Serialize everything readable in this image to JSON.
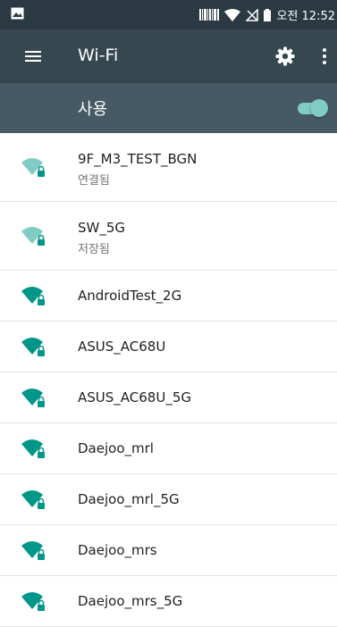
{
  "status_bar": {
    "time": "오전 12:52",
    "icons": [
      "image-icon",
      "barcode-icon",
      "wifi-icon",
      "no-sim-icon",
      "battery-icon"
    ]
  },
  "toolbar": {
    "title": "Wi-Fi",
    "icons": [
      "menu-icon",
      "gear-icon",
      "more-vert-icon"
    ]
  },
  "master_switch": {
    "label": "사용",
    "on": true
  },
  "networks": [
    {
      "ssid": "9F_M3_TEST_BGN",
      "summary": "연결됨",
      "signal": "faded"
    },
    {
      "ssid": "SW_5G",
      "summary": "저장됨",
      "signal": "faded"
    },
    {
      "ssid": "AndroidTest_2G",
      "signal": "full"
    },
    {
      "ssid": "ASUS_AC68U",
      "signal": "full"
    },
    {
      "ssid": "ASUS_AC68U_5G",
      "signal": "full"
    },
    {
      "ssid": "Daejoo_mrl",
      "signal": "full"
    },
    {
      "ssid": "Daejoo_mrl_5G",
      "signal": "full"
    },
    {
      "ssid": "Daejoo_mrs",
      "signal": "full"
    },
    {
      "ssid": "Daejoo_mrs_5G",
      "signal": "full"
    }
  ],
  "colors": {
    "status_bar": "#2b3a42",
    "toolbar": "#37474f",
    "switch_bar": "#455a64",
    "accent": "#009688",
    "accent_faded": "#80cbc4"
  }
}
